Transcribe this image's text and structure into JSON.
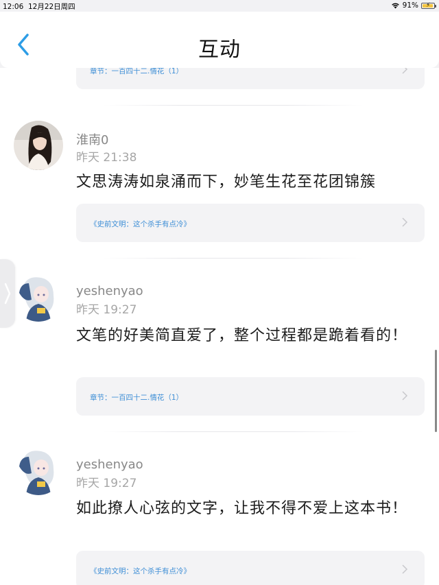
{
  "status_bar": {
    "time": "12:06",
    "date": "12月22日周四",
    "battery": "91%"
  },
  "header": {
    "title": "互动"
  },
  "comments": [
    {
      "chapter": "章节：一百四十二.情花（1）"
    },
    {
      "user": "淮南0",
      "time": "昨天 21:38",
      "text": "文思涛涛如泉涌而下，妙笔生花至花团锦簇",
      "chapter": "《史前文明：这个杀手有点冷》"
    },
    {
      "user": "yeshenyao",
      "time": "昨天 19:27",
      "text": "文笔的好美简直爱了，整个过程都是跪着看的！",
      "chapter": "章节：一百四十二.情花（1）"
    },
    {
      "user": "yeshenyao",
      "time": "昨天 19:27",
      "text": "如此撩人心弦的文字，让我不得不爱上这本书！",
      "chapter": "《史前文明：这个杀手有点冷》"
    }
  ],
  "colors": {
    "link": "#3f8fd6",
    "accent": "#2d9de6"
  }
}
